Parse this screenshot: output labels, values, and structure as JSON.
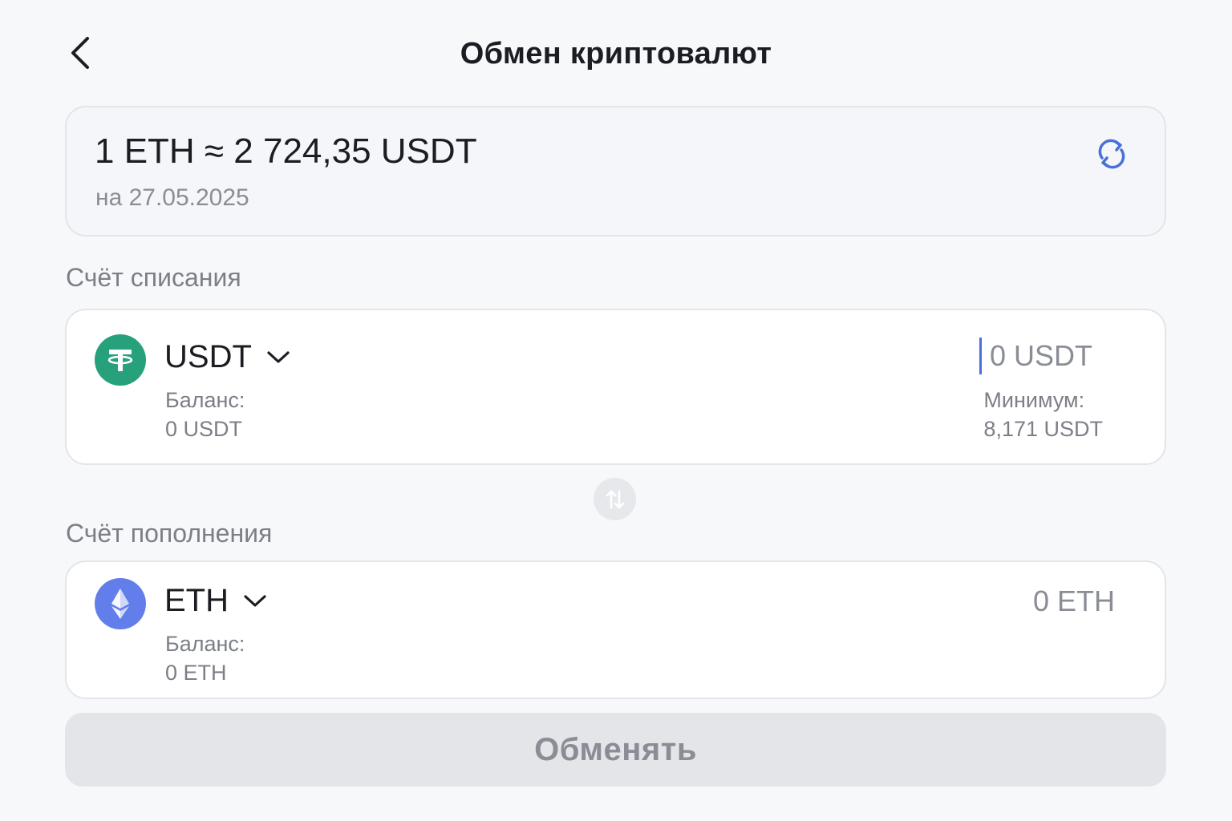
{
  "header": {
    "title": "Обмен криптовалют",
    "back_icon": "chevron-left-icon"
  },
  "rate": {
    "value": "1 ETH ≈ 2 724,35 USDT",
    "date": "на 27.05.2025",
    "refresh_icon": "refresh-icon",
    "accent_color": "#4a6fd8"
  },
  "from_account": {
    "section_label": "Счёт списания",
    "currency": "USDT",
    "icon": "tether-icon",
    "icon_color": "#26a17b",
    "balance_label": "Баланс:",
    "balance_value": "0 USDT",
    "amount": "0 USDT",
    "minimum_label": "Минимум:",
    "minimum_value": "8,171 USDT"
  },
  "swap": {
    "icon": "swap-vertical-icon"
  },
  "to_account": {
    "section_label": "Счёт пополнения",
    "currency": "ETH",
    "icon": "ethereum-icon",
    "icon_color": "#627eea",
    "balance_label": "Баланс:",
    "balance_value": "0 ETH",
    "amount": "0 ETH"
  },
  "submit": {
    "label": "Обменять",
    "disabled": true
  }
}
